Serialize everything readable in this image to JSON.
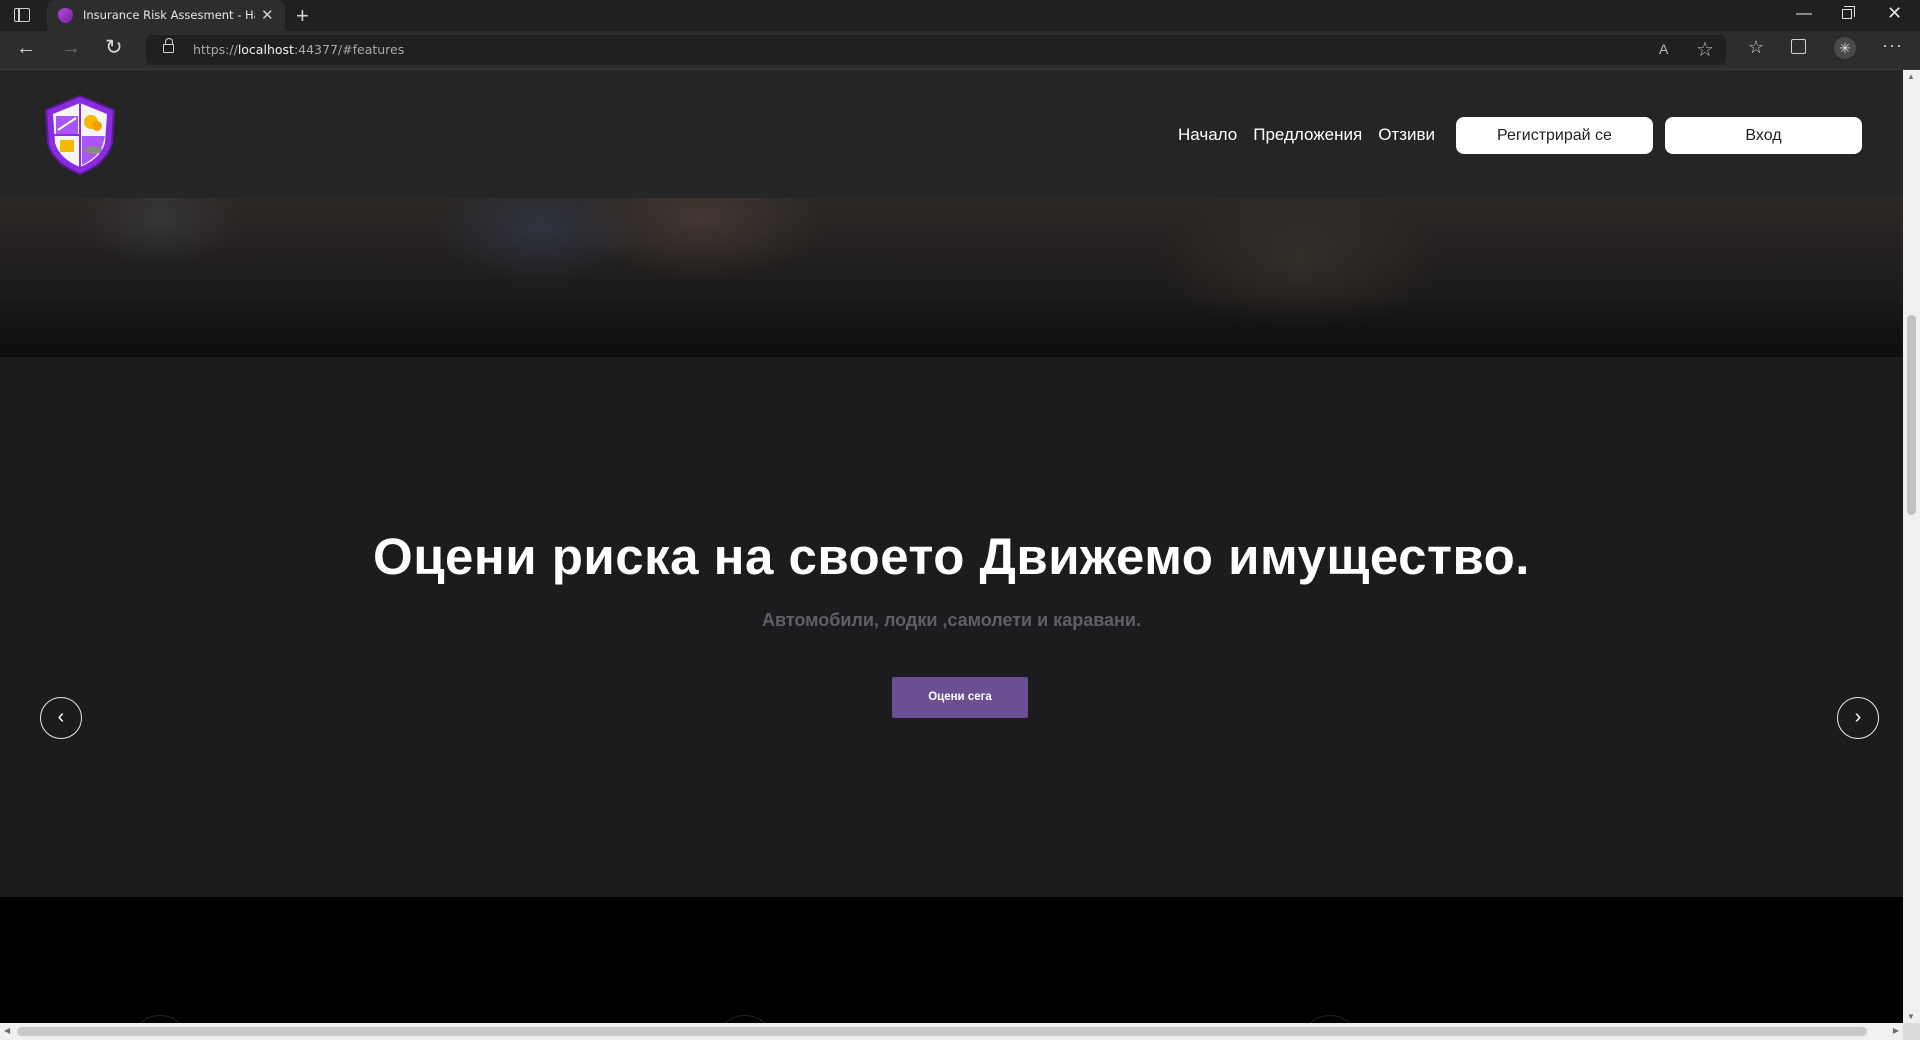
{
  "browser": {
    "tab_title": "Insurance Risk Assesment - Начало",
    "tab_close": "✕",
    "new_tab": "+",
    "url_prefix": "https://",
    "url_host": "localhost",
    "url_rest": ":44377/#features",
    "read_aloud": "A",
    "window_min": "—",
    "window_close": "✕",
    "more": "···"
  },
  "site": {
    "nav": [
      "Начало",
      "Предложения",
      "Отзиви"
    ],
    "register_label": "Регистрирай се",
    "login_label": "Вход",
    "colors": {
      "accent": "#6b4f92",
      "logo": "#8a2be2"
    }
  },
  "carousel": {
    "title": "Оцени риска на своето Движемо имущество.",
    "subtitle": "Автомобили, лодки ,самолети и каравани.",
    "cta_label": "Оцени сега",
    "prev": "‹",
    "next": "›"
  }
}
